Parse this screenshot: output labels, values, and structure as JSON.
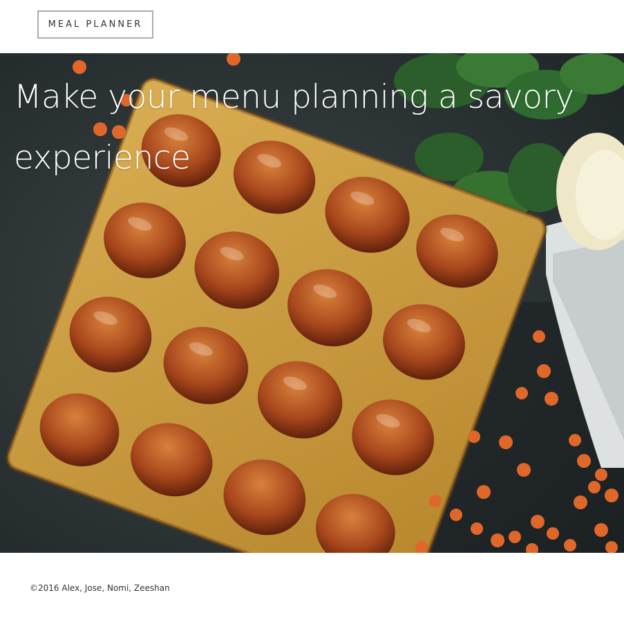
{
  "header": {
    "brand_label": "MEAL PLANNER"
  },
  "hero": {
    "title": "Make your menu planning a savory experience",
    "image_icon": "food-photo-image"
  },
  "footer": {
    "copyright": "©2016 Alex, Jose, Nomi, Zeeshan"
  },
  "colors": {
    "brand_border": "#a9b0a4",
    "text_dark": "#333333",
    "hero_text": "#ffffff",
    "slate": "#2a3133",
    "tart_crust": "#c79a3a",
    "apricot": "#a8471c",
    "mint": "#2f6b2f",
    "berry": "#e0672a"
  }
}
